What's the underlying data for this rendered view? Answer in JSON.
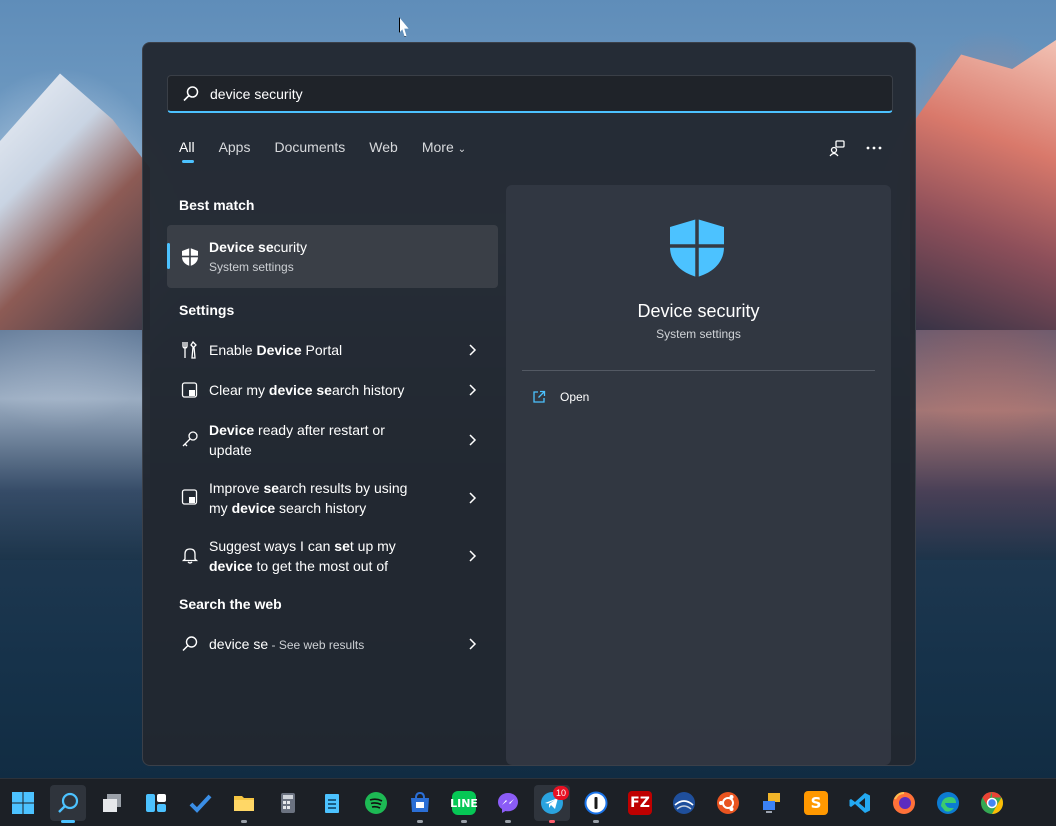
{
  "search": {
    "value": "device security",
    "icon": "search-icon"
  },
  "tabs": [
    {
      "label": "All"
    },
    {
      "label": "Apps"
    },
    {
      "label": "Documents"
    },
    {
      "label": "Web"
    },
    {
      "label": "More"
    }
  ],
  "sections": {
    "best_match": "Best match",
    "settings": "Settings",
    "web": "Search the web"
  },
  "best_match": {
    "title_bold": "Device se",
    "title_rest": "curity",
    "subtitle": "System settings"
  },
  "settings_items": [
    {
      "parts": [
        {
          "t": "Enable ",
          "b": false
        },
        {
          "t": "Device",
          "b": true
        },
        {
          "t": " Portal",
          "b": false
        }
      ]
    },
    {
      "parts": [
        {
          "t": "Clear my ",
          "b": false
        },
        {
          "t": "device",
          "b": true
        },
        {
          "t": " ",
          "b": false
        },
        {
          "t": "se",
          "b": true
        },
        {
          "t": "arch history",
          "b": false
        }
      ]
    },
    {
      "parts": [
        {
          "t": "Device",
          "b": true
        },
        {
          "t": " ready after restart or update",
          "b": false
        }
      ]
    },
    {
      "parts": [
        {
          "t": "Improve ",
          "b": false
        },
        {
          "t": "se",
          "b": true
        },
        {
          "t": "arch results by using my ",
          "b": false
        },
        {
          "t": "device",
          "b": true
        },
        {
          "t": " search history",
          "b": false
        }
      ]
    },
    {
      "parts": [
        {
          "t": "Suggest ways I can ",
          "b": false
        },
        {
          "t": "se",
          "b": true
        },
        {
          "t": "t up my ",
          "b": false
        },
        {
          "t": "device",
          "b": true
        },
        {
          "t": " to get the most out of",
          "b": false
        }
      ]
    }
  ],
  "web_result": {
    "query": "device se",
    "suffix": " - See web results"
  },
  "preview": {
    "title": "Device security",
    "subtitle": "System settings",
    "open_label": "Open"
  },
  "taskbar": {
    "telegram_badge": "10"
  },
  "colors": {
    "accent": "#4cc2ff",
    "shield": "#4cc2ff"
  }
}
